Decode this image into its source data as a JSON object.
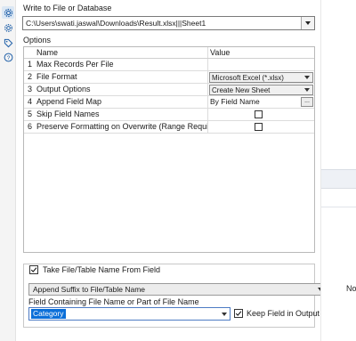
{
  "side_icons": [
    "gear-icon",
    "gear-2-icon",
    "tag-icon",
    "help-icon"
  ],
  "write_label": "Write to File or Database",
  "file_path": "C:\\Users\\swati.jaswal\\Downloads\\Result.xlsx|||Sheet1",
  "options_label": "Options",
  "grid": {
    "col_name": "Name",
    "col_value": "Value",
    "rows": [
      {
        "idx": "1",
        "name": "Max Records Per File",
        "value": ""
      },
      {
        "idx": "2",
        "name": "File Format",
        "value": "Microsoft Excel (*.xlsx)"
      },
      {
        "idx": "3",
        "name": "Output Options",
        "value": "Create New Sheet"
      },
      {
        "idx": "4",
        "name": "Append Field Map",
        "value": "By Field Name",
        "button": "..."
      },
      {
        "idx": "5",
        "name": "Skip Field Names",
        "value": ""
      },
      {
        "idx": "6",
        "name": "Preserve Formatting on Overwrite (Range Required)",
        "value": ""
      }
    ]
  },
  "take_name_label": "Take File/Table Name From Field",
  "take_name_checked": true,
  "append_suffix": "Append Suffix to File/Table Name",
  "field_containing_label": "Field Containing File Name or Part of File Name",
  "field_value": "Category",
  "keep_field_label": "Keep Field in Output",
  "keep_field_checked": true,
  "right_pane_text": "No",
  "colors": {
    "selection": "#0a6fd9",
    "rail_active": "#dbe7f4"
  }
}
